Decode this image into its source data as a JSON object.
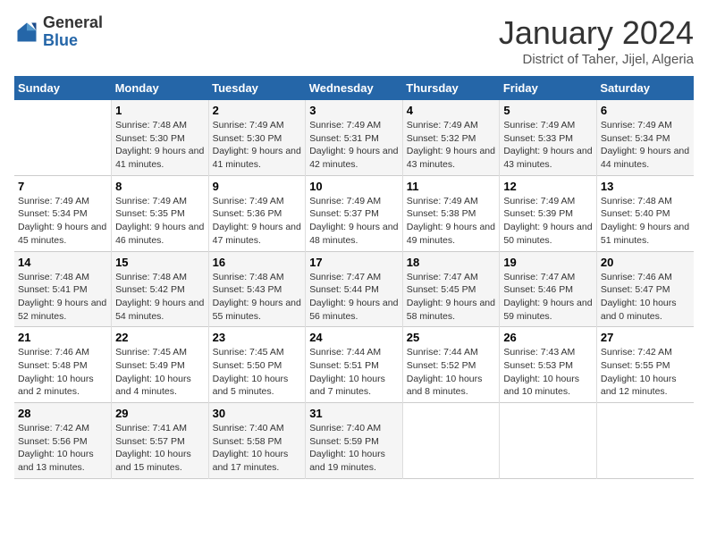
{
  "logo": {
    "general": "General",
    "blue": "Blue"
  },
  "header": {
    "month": "January 2024",
    "location": "District of Taher, Jijel, Algeria"
  },
  "weekdays": [
    "Sunday",
    "Monday",
    "Tuesday",
    "Wednesday",
    "Thursday",
    "Friday",
    "Saturday"
  ],
  "weeks": [
    [
      {
        "day": "",
        "sunrise": "",
        "sunset": "",
        "daylight": ""
      },
      {
        "day": "1",
        "sunrise": "Sunrise: 7:48 AM",
        "sunset": "Sunset: 5:30 PM",
        "daylight": "Daylight: 9 hours and 41 minutes."
      },
      {
        "day": "2",
        "sunrise": "Sunrise: 7:49 AM",
        "sunset": "Sunset: 5:30 PM",
        "daylight": "Daylight: 9 hours and 41 minutes."
      },
      {
        "day": "3",
        "sunrise": "Sunrise: 7:49 AM",
        "sunset": "Sunset: 5:31 PM",
        "daylight": "Daylight: 9 hours and 42 minutes."
      },
      {
        "day": "4",
        "sunrise": "Sunrise: 7:49 AM",
        "sunset": "Sunset: 5:32 PM",
        "daylight": "Daylight: 9 hours and 43 minutes."
      },
      {
        "day": "5",
        "sunrise": "Sunrise: 7:49 AM",
        "sunset": "Sunset: 5:33 PM",
        "daylight": "Daylight: 9 hours and 43 minutes."
      },
      {
        "day": "6",
        "sunrise": "Sunrise: 7:49 AM",
        "sunset": "Sunset: 5:34 PM",
        "daylight": "Daylight: 9 hours and 44 minutes."
      }
    ],
    [
      {
        "day": "7",
        "sunrise": "Sunrise: 7:49 AM",
        "sunset": "Sunset: 5:34 PM",
        "daylight": "Daylight: 9 hours and 45 minutes."
      },
      {
        "day": "8",
        "sunrise": "Sunrise: 7:49 AM",
        "sunset": "Sunset: 5:35 PM",
        "daylight": "Daylight: 9 hours and 46 minutes."
      },
      {
        "day": "9",
        "sunrise": "Sunrise: 7:49 AM",
        "sunset": "Sunset: 5:36 PM",
        "daylight": "Daylight: 9 hours and 47 minutes."
      },
      {
        "day": "10",
        "sunrise": "Sunrise: 7:49 AM",
        "sunset": "Sunset: 5:37 PM",
        "daylight": "Daylight: 9 hours and 48 minutes."
      },
      {
        "day": "11",
        "sunrise": "Sunrise: 7:49 AM",
        "sunset": "Sunset: 5:38 PM",
        "daylight": "Daylight: 9 hours and 49 minutes."
      },
      {
        "day": "12",
        "sunrise": "Sunrise: 7:49 AM",
        "sunset": "Sunset: 5:39 PM",
        "daylight": "Daylight: 9 hours and 50 minutes."
      },
      {
        "day": "13",
        "sunrise": "Sunrise: 7:48 AM",
        "sunset": "Sunset: 5:40 PM",
        "daylight": "Daylight: 9 hours and 51 minutes."
      }
    ],
    [
      {
        "day": "14",
        "sunrise": "Sunrise: 7:48 AM",
        "sunset": "Sunset: 5:41 PM",
        "daylight": "Daylight: 9 hours and 52 minutes."
      },
      {
        "day": "15",
        "sunrise": "Sunrise: 7:48 AM",
        "sunset": "Sunset: 5:42 PM",
        "daylight": "Daylight: 9 hours and 54 minutes."
      },
      {
        "day": "16",
        "sunrise": "Sunrise: 7:48 AM",
        "sunset": "Sunset: 5:43 PM",
        "daylight": "Daylight: 9 hours and 55 minutes."
      },
      {
        "day": "17",
        "sunrise": "Sunrise: 7:47 AM",
        "sunset": "Sunset: 5:44 PM",
        "daylight": "Daylight: 9 hours and 56 minutes."
      },
      {
        "day": "18",
        "sunrise": "Sunrise: 7:47 AM",
        "sunset": "Sunset: 5:45 PM",
        "daylight": "Daylight: 9 hours and 58 minutes."
      },
      {
        "day": "19",
        "sunrise": "Sunrise: 7:47 AM",
        "sunset": "Sunset: 5:46 PM",
        "daylight": "Daylight: 9 hours and 59 minutes."
      },
      {
        "day": "20",
        "sunrise": "Sunrise: 7:46 AM",
        "sunset": "Sunset: 5:47 PM",
        "daylight": "Daylight: 10 hours and 0 minutes."
      }
    ],
    [
      {
        "day": "21",
        "sunrise": "Sunrise: 7:46 AM",
        "sunset": "Sunset: 5:48 PM",
        "daylight": "Daylight: 10 hours and 2 minutes."
      },
      {
        "day": "22",
        "sunrise": "Sunrise: 7:45 AM",
        "sunset": "Sunset: 5:49 PM",
        "daylight": "Daylight: 10 hours and 4 minutes."
      },
      {
        "day": "23",
        "sunrise": "Sunrise: 7:45 AM",
        "sunset": "Sunset: 5:50 PM",
        "daylight": "Daylight: 10 hours and 5 minutes."
      },
      {
        "day": "24",
        "sunrise": "Sunrise: 7:44 AM",
        "sunset": "Sunset: 5:51 PM",
        "daylight": "Daylight: 10 hours and 7 minutes."
      },
      {
        "day": "25",
        "sunrise": "Sunrise: 7:44 AM",
        "sunset": "Sunset: 5:52 PM",
        "daylight": "Daylight: 10 hours and 8 minutes."
      },
      {
        "day": "26",
        "sunrise": "Sunrise: 7:43 AM",
        "sunset": "Sunset: 5:53 PM",
        "daylight": "Daylight: 10 hours and 10 minutes."
      },
      {
        "day": "27",
        "sunrise": "Sunrise: 7:42 AM",
        "sunset": "Sunset: 5:55 PM",
        "daylight": "Daylight: 10 hours and 12 minutes."
      }
    ],
    [
      {
        "day": "28",
        "sunrise": "Sunrise: 7:42 AM",
        "sunset": "Sunset: 5:56 PM",
        "daylight": "Daylight: 10 hours and 13 minutes."
      },
      {
        "day": "29",
        "sunrise": "Sunrise: 7:41 AM",
        "sunset": "Sunset: 5:57 PM",
        "daylight": "Daylight: 10 hours and 15 minutes."
      },
      {
        "day": "30",
        "sunrise": "Sunrise: 7:40 AM",
        "sunset": "Sunset: 5:58 PM",
        "daylight": "Daylight: 10 hours and 17 minutes."
      },
      {
        "day": "31",
        "sunrise": "Sunrise: 7:40 AM",
        "sunset": "Sunset: 5:59 PM",
        "daylight": "Daylight: 10 hours and 19 minutes."
      },
      {
        "day": "",
        "sunrise": "",
        "sunset": "",
        "daylight": ""
      },
      {
        "day": "",
        "sunrise": "",
        "sunset": "",
        "daylight": ""
      },
      {
        "day": "",
        "sunrise": "",
        "sunset": "",
        "daylight": ""
      }
    ]
  ]
}
